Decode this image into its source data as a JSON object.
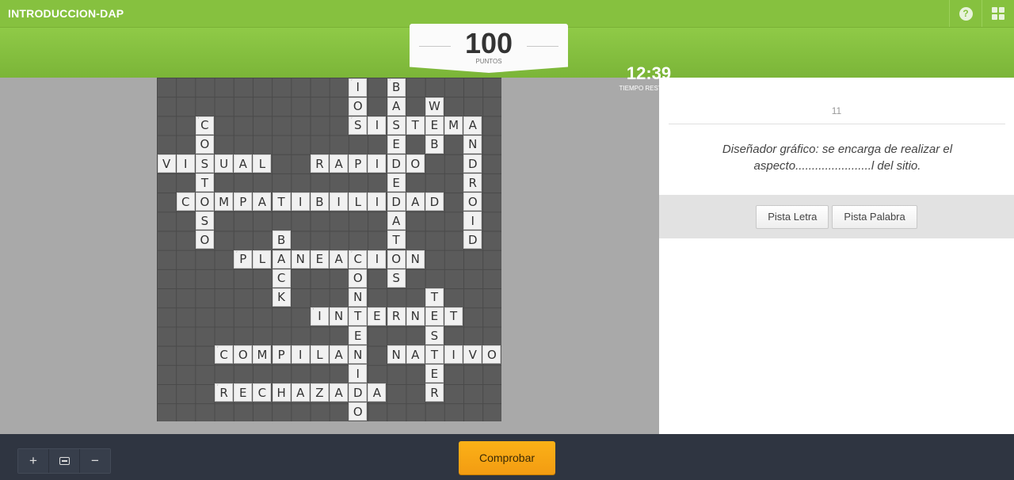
{
  "app": {
    "title": "INTRODUCCION-DAP"
  },
  "toolbar": {
    "help_icon": "help-icon",
    "menu_icon": "grid-menu-icon"
  },
  "score": {
    "value": "100",
    "label": "PUNTOS"
  },
  "timer": {
    "value": "12:39",
    "label": "TIEMPO RESTANTE"
  },
  "clue": {
    "number": "11",
    "text": "Diseñador gráfico: se encarga de realizar el aspecto.......................l del sitio."
  },
  "hints": {
    "letter": "Pista Letra",
    "word": "Pista Palabra"
  },
  "zoom": {
    "in": "+",
    "fit": "fit-icon",
    "out": "−"
  },
  "check_label": "Comprobar",
  "board": {
    "cols": 18,
    "rows": 18,
    "words": [
      {
        "word": "IOS",
        "row": 0,
        "col": 10,
        "dir": "down"
      },
      {
        "word": "BASEDEDATOS",
        "row": 0,
        "col": 12,
        "dir": "down"
      },
      {
        "word": "WEB",
        "row": 1,
        "col": 14,
        "dir": "down"
      },
      {
        "word": "SISTEMA",
        "row": 2,
        "col": 10,
        "dir": "across"
      },
      {
        "word": "ANDROID",
        "row": 2,
        "col": 16,
        "dir": "down"
      },
      {
        "word": "COSTOSO",
        "row": 2,
        "col": 2,
        "dir": "down"
      },
      {
        "word": "VISUAL",
        "row": 4,
        "col": 0,
        "dir": "across"
      },
      {
        "word": "RAPIDO",
        "row": 4,
        "col": 8,
        "dir": "across"
      },
      {
        "word": "COMPATIBILIDAD",
        "row": 6,
        "col": 1,
        "dir": "across"
      },
      {
        "word": "BACK",
        "row": 8,
        "col": 6,
        "dir": "down"
      },
      {
        "word": "PLANEACION",
        "row": 9,
        "col": 4,
        "dir": "across"
      },
      {
        "word": "CONTENIDO",
        "row": 9,
        "col": 10,
        "dir": "down"
      },
      {
        "word": "TESTER",
        "row": 11,
        "col": 14,
        "dir": "down"
      },
      {
        "word": "INTERNET",
        "row": 12,
        "col": 8,
        "dir": "across"
      },
      {
        "word": "COMPILAN",
        "row": 14,
        "col": 3,
        "dir": "across"
      },
      {
        "word": "NATIVO",
        "row": 14,
        "col": 12,
        "dir": "across"
      },
      {
        "word": "RECHAZADA",
        "row": 16,
        "col": 3,
        "dir": "across"
      }
    ],
    "numbered_cells": [
      [
        0,
        10
      ],
      [
        0,
        12
      ],
      [
        2,
        2
      ],
      [
        2,
        10
      ],
      [
        9,
        4
      ],
      [
        9,
        10
      ],
      [
        12,
        8
      ],
      [
        14,
        3
      ],
      [
        16,
        3
      ]
    ]
  }
}
